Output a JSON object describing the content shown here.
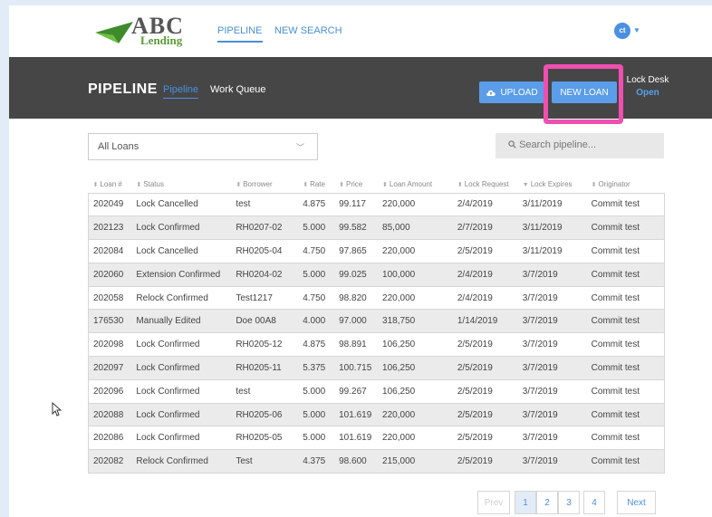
{
  "topnav": {
    "logo_word": "ABC",
    "logo_sub": "Lending",
    "pipeline": "PIPELINE",
    "new_search": "NEW SEARCH",
    "avatar_initials": "ct"
  },
  "header": {
    "title": "PIPELINE",
    "tab_pipeline": "Pipeline",
    "tab_work_queue": "Work Queue",
    "upload": "UPLOAD",
    "new_loan": "NEW LOAN",
    "lock_desk": "Lock Desk",
    "lock_desk_status": "Open"
  },
  "filter": {
    "selected": "All Loans",
    "search_placeholder": "Search pipeline..."
  },
  "table": {
    "columns": [
      "Loan #",
      "Status",
      "Borrower",
      "Rate",
      "Price",
      "Loan Amount",
      "Lock Request",
      "Lock Expires",
      "Originator"
    ],
    "rows": [
      [
        "202049",
        "Lock Cancelled",
        "test",
        "4.875",
        "99.117",
        "220,000",
        "2/4/2019",
        "3/11/2019",
        "Commit test"
      ],
      [
        "202123",
        "Lock Confirmed",
        "RH0207-02",
        "5.000",
        "99.582",
        "85,000",
        "2/7/2019",
        "3/11/2019",
        "Commit test"
      ],
      [
        "202084",
        "Lock Cancelled",
        "RH0205-04",
        "4.750",
        "97.865",
        "220,000",
        "2/5/2019",
        "3/11/2019",
        "Commit test"
      ],
      [
        "202060",
        "Extension Confirmed",
        "RH0204-02",
        "5.000",
        "99.025",
        "100,000",
        "2/4/2019",
        "3/7/2019",
        "Commit test"
      ],
      [
        "202058",
        "Relock Confirmed",
        "Test1217",
        "4.750",
        "98.820",
        "220,000",
        "2/4/2019",
        "3/7/2019",
        "Commit test"
      ],
      [
        "176530",
        "Manually Edited",
        "Doe 00A8",
        "4.000",
        "97.000",
        "318,750",
        "1/14/2019",
        "3/7/2019",
        "Commit test"
      ],
      [
        "202098",
        "Lock Confirmed",
        "RH0205-12",
        "4.875",
        "98.891",
        "106,250",
        "2/5/2019",
        "3/7/2019",
        "Commit test"
      ],
      [
        "202097",
        "Lock Confirmed",
        "RH0205-11",
        "5.375",
        "100.715",
        "106,250",
        "2/5/2019",
        "3/7/2019",
        "Commit test"
      ],
      [
        "202096",
        "Lock Confirmed",
        "test",
        "5.000",
        "99.267",
        "106,250",
        "2/5/2019",
        "3/7/2019",
        "Commit test"
      ],
      [
        "202088",
        "Lock Confirmed",
        "RH0205-06",
        "5.000",
        "101.619",
        "220,000",
        "2/5/2019",
        "3/7/2019",
        "Commit test"
      ],
      [
        "202086",
        "Lock Confirmed",
        "RH0205-05",
        "5.000",
        "101.619",
        "220,000",
        "2/5/2019",
        "3/7/2019",
        "Commit test"
      ],
      [
        "202082",
        "Relock Confirmed",
        "Test",
        "4.375",
        "98.600",
        "215,000",
        "2/5/2019",
        "3/7/2019",
        "Commit test"
      ]
    ]
  },
  "pagination": {
    "prev": "Prev",
    "pages": [
      "1",
      "2",
      "3",
      "4"
    ],
    "next": "Next",
    "current": "1"
  },
  "colors": {
    "accent": "#4a90e2",
    "header_bg": "#464646",
    "highlight": "#f04fb0"
  }
}
